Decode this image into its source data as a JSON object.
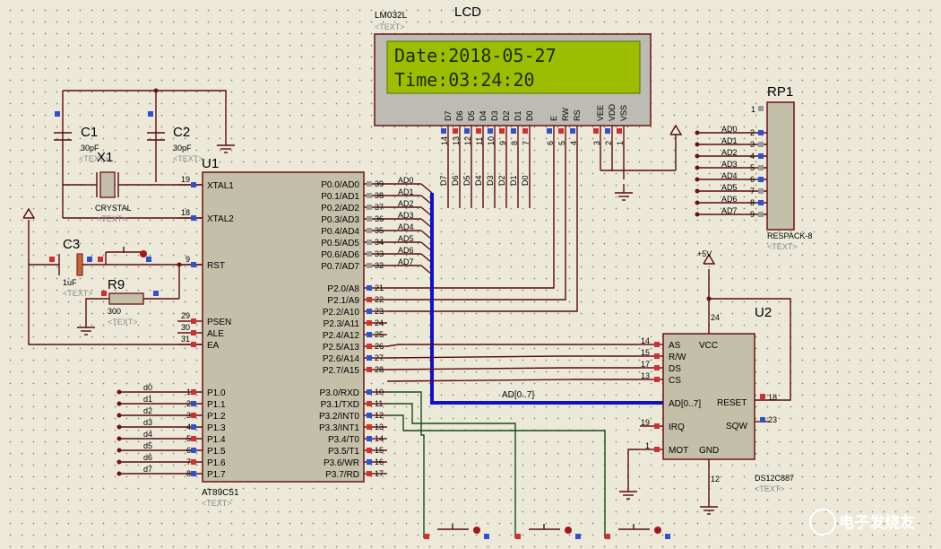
{
  "lcd": {
    "model": "LM032L",
    "title": "LCD",
    "text_tag": "<TEXT>",
    "line1": "Date:2018-05-27",
    "line2": "Time:03:24:20",
    "pin_labels": [
      "D7",
      "D6",
      "D5",
      "D4",
      "D3",
      "D2",
      "D1",
      "D0",
      "E",
      "RW",
      "RS",
      "VEE",
      "VDD",
      "VSS"
    ],
    "pin_numbers": [
      "14",
      "13",
      "12",
      "11",
      "10",
      "9",
      "8",
      "7",
      "6",
      "5",
      "4",
      "3",
      "2",
      "1"
    ]
  },
  "data_lines": [
    "D7",
    "D6",
    "D5",
    "D4",
    "D3",
    "D2",
    "D1",
    "D0"
  ],
  "rp1": {
    "ref": "RP1",
    "value": "RESPACK-8",
    "text_tag": "<TEXT>",
    "top_pin": "1",
    "labels": [
      "AD0",
      "AD1",
      "AD2",
      "AD3",
      "AD4",
      "AD5",
      "AD6",
      "AD7"
    ],
    "pins": [
      "2",
      "3",
      "4",
      "5",
      "6",
      "7",
      "8",
      "9"
    ]
  },
  "caps": {
    "c1_ref": "C1",
    "c1_val": "30pF",
    "c2_ref": "C2",
    "c2_val": "30pF",
    "c3_ref": "C3",
    "c3_val": "1uF",
    "text_tag": "<TEXT>"
  },
  "crystal": {
    "ref": "X1",
    "value": "CRYSTAL",
    "text_tag": "<TEXT>"
  },
  "r9": {
    "ref": "R9",
    "value": "300",
    "text_tag": "<TEXT>"
  },
  "u1": {
    "ref": "U1",
    "part": "AT89C51",
    "text_tag": "<TEXT>",
    "left_pins": [
      {
        "num": "19",
        "name": "XTAL1"
      },
      {
        "num": "18",
        "name": "XTAL2"
      },
      {
        "num": "9",
        "name": "RST"
      },
      {
        "num": "29",
        "name": "PSEN"
      },
      {
        "num": "30",
        "name": "ALE"
      },
      {
        "num": "31",
        "name": "EA"
      }
    ],
    "p1_pins": [
      {
        "num": "1",
        "name": "P1.0",
        "net": "d0"
      },
      {
        "num": "2",
        "name": "P1.1",
        "net": "d1"
      },
      {
        "num": "3",
        "name": "P1.2",
        "net": "d2"
      },
      {
        "num": "4",
        "name": "P1.3",
        "net": "d3"
      },
      {
        "num": "5",
        "name": "P1.4",
        "net": "d4"
      },
      {
        "num": "6",
        "name": "P1.5",
        "net": "d5"
      },
      {
        "num": "7",
        "name": "P1.6",
        "net": "d6"
      },
      {
        "num": "8",
        "name": "P1.7",
        "net": "d7"
      }
    ],
    "p0_pins": [
      {
        "num": "39",
        "name": "P0.0/AD0",
        "net": "AD0"
      },
      {
        "num": "38",
        "name": "P0.1/AD1",
        "net": "AD1"
      },
      {
        "num": "37",
        "name": "P0.2/AD2",
        "net": "AD2"
      },
      {
        "num": "36",
        "name": "P0.3/AD3",
        "net": "AD3"
      },
      {
        "num": "35",
        "name": "P0.4/AD4",
        "net": "AD4"
      },
      {
        "num": "34",
        "name": "P0.5/AD5",
        "net": "AD5"
      },
      {
        "num": "33",
        "name": "P0.6/AD6",
        "net": "AD6"
      },
      {
        "num": "32",
        "name": "P0.7/AD7",
        "net": "AD7"
      }
    ],
    "p2_pins": [
      {
        "num": "21",
        "name": "P2.0/A8"
      },
      {
        "num": "22",
        "name": "P2.1/A9"
      },
      {
        "num": "23",
        "name": "P2.2/A10"
      },
      {
        "num": "24",
        "name": "P2.3/A11"
      },
      {
        "num": "25",
        "name": "P2.4/A12"
      },
      {
        "num": "26",
        "name": "P2.5/A13"
      },
      {
        "num": "27",
        "name": "P2.6/A14"
      },
      {
        "num": "28",
        "name": "P2.7/A15"
      }
    ],
    "p3_pins": [
      {
        "num": "10",
        "name": "P3.0/RXD"
      },
      {
        "num": "11",
        "name": "P3.1/TXD"
      },
      {
        "num": "12",
        "name": "P3.2/INT0"
      },
      {
        "num": "13",
        "name": "P3.3/INT1"
      },
      {
        "num": "14",
        "name": "P3.4/T0"
      },
      {
        "num": "15",
        "name": "P3.5/T1"
      },
      {
        "num": "16",
        "name": "P3.6/WR"
      },
      {
        "num": "17",
        "name": "P3.7/RD"
      }
    ]
  },
  "u2": {
    "ref": "U2",
    "part": "DS12C887",
    "text_tag": "<TEXT>",
    "left_pins": [
      {
        "num": "14",
        "name": "AS"
      },
      {
        "num": "15",
        "name": "R/W"
      },
      {
        "num": "17",
        "name": "DS"
      },
      {
        "num": "13",
        "name": "CS"
      },
      {
        "num": "",
        "name": "AD[0..7]"
      },
      {
        "num": "19",
        "name": "IRQ"
      },
      {
        "num": "1",
        "name": "MOT"
      }
    ],
    "vcc": "VCC",
    "vcc_pin": "24",
    "gnd": "GND",
    "gnd_pin": "12",
    "reset": "RESET",
    "reset_pin": "18",
    "sqw": "SQW",
    "sqw_pin": "23"
  },
  "bus_label": "AD[0..7]",
  "power_label": "+5V",
  "watermark": "电子发烧友"
}
